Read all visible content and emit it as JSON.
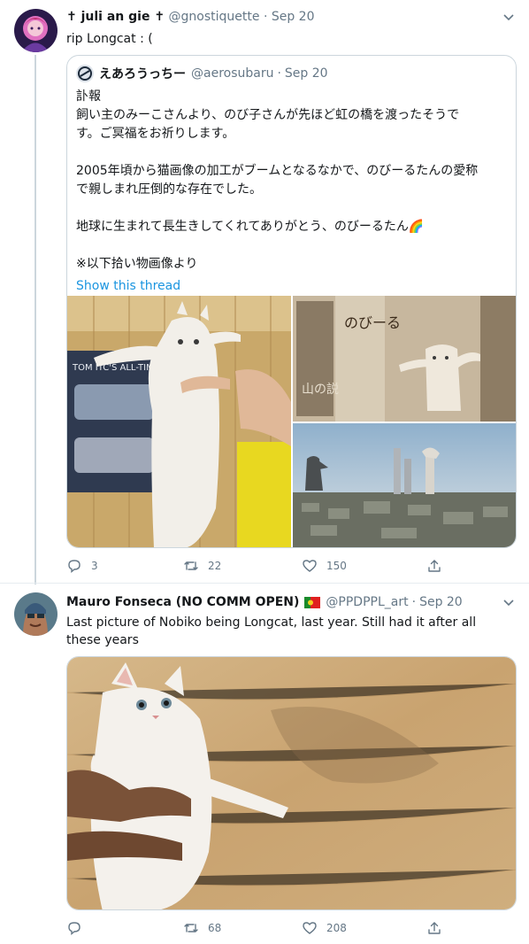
{
  "tweet1": {
    "display_name": "✝ juli an gie ✝",
    "handle": "@gnostiquette",
    "date": "Sep 20",
    "text": "rip Longcat : (",
    "quote": {
      "display_name": "えあろうっちー",
      "handle": "@aerosubaru",
      "date": "Sep 20",
      "lines": [
        "訃報",
        "飼い主のみーこさんより、のび子さんが先ほど虹の橋を渡ったそうで",
        "す。ご冥福をお祈りします。",
        "",
        "2005年頃から猫画像の加工がブームとなるなかで、のびーるたんの愛称",
        "で親しまれ圧倒的な存在でした。",
        "",
        "地球に生まれて長生きしてくれてありがとう、のびーるたん🌈",
        "",
        "※以下拾い物画像より"
      ],
      "show_thread": "Show this thread",
      "poster_text": "のびーる",
      "poster_text2": "山の説"
    },
    "actions": {
      "replies": "3",
      "retweets": "22",
      "likes": "150"
    }
  },
  "tweet2": {
    "display_name": "Mauro Fonseca (NO COMM OPEN)",
    "handle": "@PPDPPL_art",
    "date": "Sep 20",
    "text": "Last picture of Nobiko being Longcat, last year. Still had it after all these years",
    "actions": {
      "replies": "",
      "retweets": "68",
      "likes": "208"
    }
  },
  "icons": {
    "reply": "reply-icon",
    "retweet": "retweet-icon",
    "like": "like-icon",
    "share": "share-icon",
    "more": "chevron-down-icon",
    "flag": "portugal-flag-icon"
  },
  "colors": {
    "link": "#1b95e0",
    "secondary_text": "#657786",
    "border": "#ccd6dd"
  }
}
